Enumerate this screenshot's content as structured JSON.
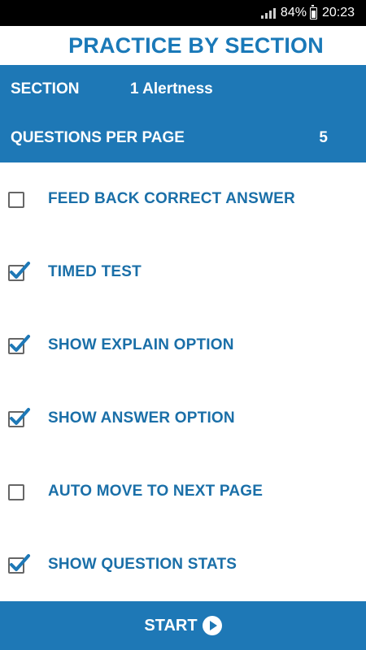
{
  "status_bar": {
    "battery_percent": "84%",
    "time": "20:23",
    "icons": [
      "signal-icon",
      "battery-charging-icon"
    ]
  },
  "title": "PRACTICE BY SECTION",
  "settings": {
    "section_label": "SECTION",
    "section_value": "1 Alertness",
    "questions_per_page_label": "QUESTIONS PER PAGE",
    "questions_per_page_value": "5"
  },
  "options": [
    {
      "label": "FEED BACK CORRECT ANSWER",
      "checked": false
    },
    {
      "label": "TIMED TEST",
      "checked": true
    },
    {
      "label": "SHOW EXPLAIN OPTION",
      "checked": true
    },
    {
      "label": "SHOW ANSWER OPTION",
      "checked": true
    },
    {
      "label": "AUTO MOVE TO NEXT PAGE",
      "checked": false
    },
    {
      "label": "SHOW QUESTION STATS",
      "checked": true
    }
  ],
  "start_button": {
    "label": "START",
    "icon": "play-circle-icon"
  },
  "colors": {
    "accent": "#1e78b6",
    "title_text": "#1a79b8",
    "option_text": "#1a6fa8",
    "check": "#1e78b6"
  }
}
